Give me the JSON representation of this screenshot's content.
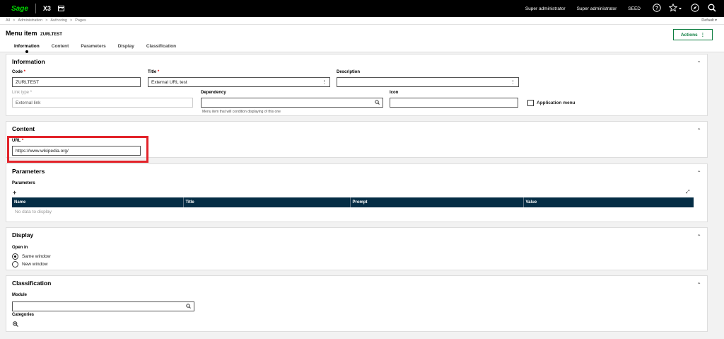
{
  "topbar": {
    "logo": "Sage",
    "app": "X3",
    "calendar_icon": "calendar-icon",
    "user1": "Super administrator",
    "user2": "Super administrator",
    "folder": "SEED",
    "help_glyph": "?",
    "star_glyph": "☆",
    "compass_glyph": "⊘",
    "search_glyph": "⌕"
  },
  "breadcrumb": {
    "items": [
      "All",
      ">",
      "Administration",
      ">",
      "Authoring",
      ">",
      "Pages"
    ],
    "right": "Default ▾"
  },
  "header": {
    "title": "Menu item",
    "code": "ZURLTEST",
    "actions_label": "Actions",
    "actions_glyph": "⋮",
    "tabs": [
      "Information",
      "Content",
      "Parameters",
      "Display",
      "Classification"
    ]
  },
  "information": {
    "heading": "Information",
    "code_label": "Code",
    "code_value": "ZURLTEST",
    "title_label": "Title",
    "title_value": "External URL test",
    "description_label": "Description",
    "description_value": "",
    "link_type_label": "Link type",
    "link_type_value": "External link",
    "dependency_label": "Dependency",
    "dependency_value": "",
    "dependency_help": "Menu item that will condition displaying of this one",
    "icon_label": "Icon",
    "icon_value": "",
    "app_menu_label": "Application menu",
    "req": "*"
  },
  "content": {
    "heading": "Content",
    "url_label": "URL",
    "url_value": "https://www.wikipedia.org/",
    "req": "*"
  },
  "parameters": {
    "heading": "Parameters",
    "sub_label": "Parameters",
    "add_glyph": "+",
    "expand_glyph": "⤢",
    "columns": [
      "Name",
      "Title",
      "Prompt",
      "Value"
    ],
    "empty": "No data to display"
  },
  "display": {
    "heading": "Display",
    "open_in_label": "Open in",
    "options": [
      "Same window",
      "New window"
    ],
    "selected": "Same window"
  },
  "classification": {
    "heading": "Classification",
    "module_label": "Module",
    "module_value": "",
    "categories_label": "Categories",
    "zoom_glyph": "⊕"
  },
  "chevron": "⌃",
  "colors": {
    "accent": "#0a7c3e",
    "grid_header": "#052d45",
    "highlight": "#e2232a",
    "logo": "#00dc00"
  }
}
